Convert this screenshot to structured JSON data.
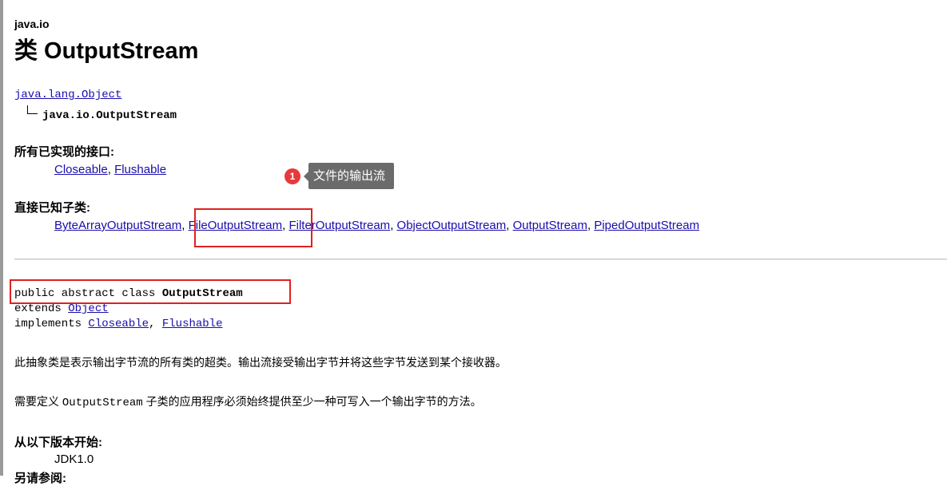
{
  "package": "java.io",
  "title": "类 OutputStream",
  "inheritance": {
    "parent": "java.lang.Object",
    "current": "java.io.OutputStream"
  },
  "interfaces": {
    "heading": "所有已实现的接口:",
    "items": [
      "Closeable",
      "Flushable"
    ]
  },
  "subclasses": {
    "heading": "直接已知子类:",
    "items": [
      "ByteArrayOutputStream",
      "FileOutputStream",
      "FilterOutputStream",
      "ObjectOutputStream",
      "OutputStream",
      "PipedOutputStream"
    ]
  },
  "signature": {
    "line1_prefix": "public abstract class ",
    "class_name": "OutputStream",
    "extends_kw": "extends ",
    "extends_link": "Object",
    "implements_kw": "implements ",
    "implements_links": [
      "Closeable",
      "Flushable"
    ]
  },
  "description": {
    "p1": "此抽象类是表示输出字节流的所有类的超类。输出流接受输出字节并将这些字节发送到某个接收器。",
    "p2_before": "需要定义 ",
    "p2_code": "OutputStream",
    "p2_after": " 子类的应用程序必须始终提供至少一种可写入一个输出字节的方法。"
  },
  "since": {
    "heading": "从以下版本开始:",
    "value": "JDK1.0"
  },
  "see_also": {
    "heading": "另请参阅:"
  },
  "annotation": {
    "number": "1",
    "text": "文件的输出流",
    "highlight_color": "#e02020",
    "badge_color": "#e8393b"
  }
}
